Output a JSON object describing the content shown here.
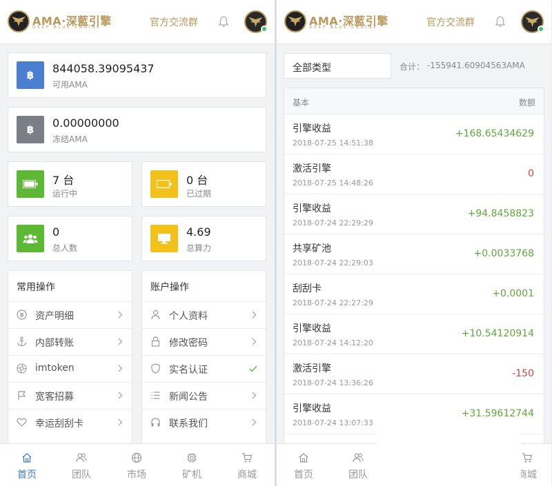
{
  "header": {
    "logo_title": "AMA·深藍引擎",
    "logo_subtitle": "DEEP BLUE ENGINE",
    "group_link": "官方交流群"
  },
  "balances": [
    {
      "icon": "bitcoin-icon",
      "value": "844058.39095437",
      "label": "可用AMA",
      "color": "#4a7fcf"
    },
    {
      "icon": "bitcoin-icon",
      "value": "0.00000000",
      "label": "冻结AMA",
      "color": "#7a7f87"
    }
  ],
  "stats": [
    {
      "icon": "battery-full-icon",
      "value": "7 台",
      "label": "运行中",
      "color": "#5db934"
    },
    {
      "icon": "battery-empty-icon",
      "value": "0 台",
      "label": "已过期",
      "color": "#f2c21a"
    },
    {
      "icon": "users-icon",
      "value": "0",
      "label": "总人数",
      "color": "#5db934"
    },
    {
      "icon": "monitor-icon",
      "value": "4.69",
      "label": "总算力",
      "color": "#f2c21a"
    }
  ],
  "common_ops": {
    "title": "常用操作",
    "items": [
      "资产明细",
      "内部转账",
      "imtoken",
      "宽客招募",
      "幸运刮刮卡"
    ]
  },
  "account_ops": {
    "title": "账户操作",
    "items": [
      "个人资料",
      "修改密码",
      "实名认证",
      "新闻公告",
      "联系我们"
    ]
  },
  "nav": [
    "首页",
    "团队",
    "市场",
    "矿机",
    "商城"
  ],
  "right": {
    "filter": "全部类型",
    "total_label": "合计：",
    "total_value": "-155941.60904563AMA",
    "col_basic": "基本",
    "col_amount": "数额",
    "records": [
      {
        "title": "引擎收益",
        "time": "2018-07-25 14:51:38",
        "amount": "+168.65434629",
        "sign": "pos"
      },
      {
        "title": "激活引擎",
        "time": "2018-07-25 14:48:26",
        "amount": "0",
        "sign": "neg"
      },
      {
        "title": "引擎收益",
        "time": "2018-07-24 22:29:29",
        "amount": "+94.8458823",
        "sign": "pos"
      },
      {
        "title": "共享矿池",
        "time": "2018-07-24 22:29:03",
        "amount": "+0.0033768",
        "sign": "pos"
      },
      {
        "title": "刮刮卡",
        "time": "2018-07-24 22:27:29",
        "amount": "+0.0001",
        "sign": "pos"
      },
      {
        "title": "引擎收益",
        "time": "2018-07-24 14:12:20",
        "amount": "+10.54120914",
        "sign": "pos"
      },
      {
        "title": "激活引擎",
        "time": "2018-07-24 13:36:26",
        "amount": "-150",
        "sign": "neg"
      },
      {
        "title": "引擎收益",
        "time": "2018-07-24 13:07:33",
        "amount": "+31.59612744",
        "sign": "pos"
      }
    ],
    "nav_visible": [
      "首页",
      "团队",
      "商城"
    ]
  }
}
